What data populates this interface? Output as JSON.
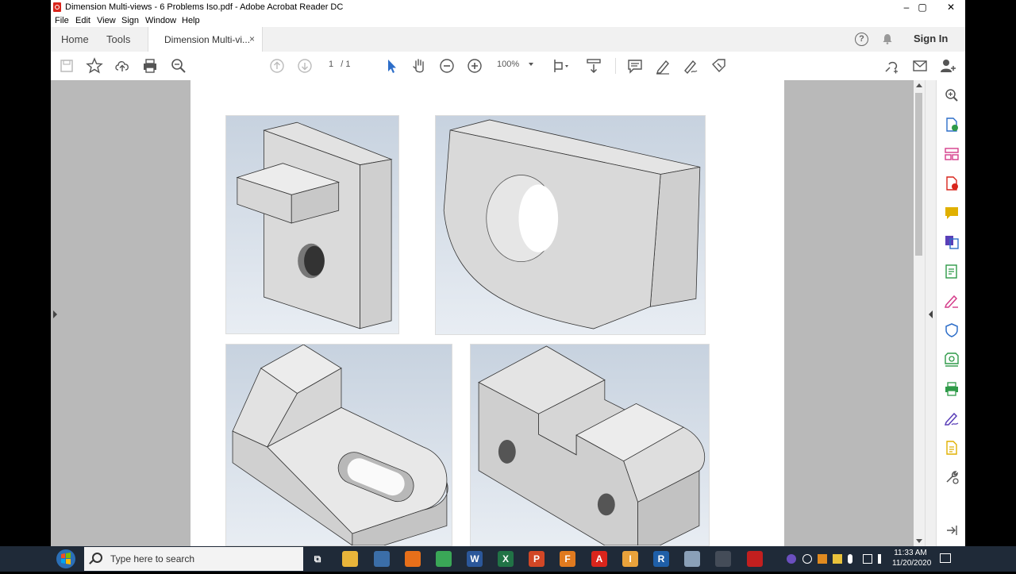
{
  "window": {
    "title": "Dimension Multi-views - 6 Problems Iso.pdf - Adobe Acrobat Reader DC",
    "controls": {
      "minimize": "–",
      "maximize": "▢",
      "close": "✕"
    }
  },
  "menu": [
    "File",
    "Edit",
    "View",
    "Sign",
    "Window",
    "Help"
  ],
  "tabs": {
    "home": "Home",
    "tools": "Tools",
    "document": "Dimension Multi-vi...",
    "close": "×"
  },
  "header": {
    "help": "?",
    "sign_in": "Sign In"
  },
  "toolbar": {
    "current_page": "1",
    "page_total": "/ 1",
    "zoom": "100%",
    "icons": [
      "save-icon",
      "bookmark-star-icon",
      "upload-cloud-icon",
      "print-icon",
      "find-magnifier-icon",
      "page-up-icon",
      "page-down-icon",
      "select-cursor-icon",
      "hand-pan-icon",
      "zoom-out-icon",
      "zoom-in-icon",
      "fit-page-icon",
      "scroll-mode-icon",
      "comment-icon",
      "highlight-pen-icon",
      "sign-icon",
      "fill-sign-icon",
      "share-link-icon",
      "email-icon",
      "add-user-icon"
    ]
  },
  "right_pane_tools": [
    "search-zoom-icon",
    "export-pdf-icon",
    "organize-pages-icon",
    "create-pdf-icon",
    "comment-icon",
    "combine-files-icon",
    "edit-pdf-icon",
    "fill-sign-icon",
    "protect-shield-icon",
    "scan-ocr-icon",
    "print-production-icon",
    "send-sign-icon",
    "rich-media-icon",
    "more-tools-wrench-icon",
    "collapse-pane-icon"
  ],
  "taskbar": {
    "search_placeholder": "Type here to search",
    "time": "11:33 AM",
    "date": "11/20/2020",
    "apps": [
      {
        "name": "task-view",
        "label": "⧉",
        "color": "#1f2a38"
      },
      {
        "name": "file-explorer",
        "label": "",
        "color": "#e8b43a"
      },
      {
        "name": "calculator",
        "label": "",
        "color": "#3b6ea8"
      },
      {
        "name": "firefox",
        "label": "",
        "color": "#e76f1a"
      },
      {
        "name": "chrome",
        "label": "",
        "color": "#3aa757"
      },
      {
        "name": "word",
        "label": "W",
        "color": "#2b579a"
      },
      {
        "name": "excel",
        "label": "X",
        "color": "#217346"
      },
      {
        "name": "powerpoint",
        "label": "P",
        "color": "#d24726"
      },
      {
        "name": "app-f",
        "label": "F",
        "color": "#e07a1f"
      },
      {
        "name": "acrobat",
        "label": "A",
        "color": "#d9251c"
      },
      {
        "name": "app-i",
        "label": "I",
        "color": "#e9a23b"
      },
      {
        "name": "revit",
        "label": "R",
        "color": "#1f5fa8"
      },
      {
        "name": "app-cloud",
        "label": "",
        "color": "#8aa0b8"
      },
      {
        "name": "app-disc",
        "label": "",
        "color": "#444c58"
      },
      {
        "name": "acrobat-reader",
        "label": "",
        "color": "#c21f1f"
      }
    ]
  },
  "colors": {
    "accent_red": "#d9251c",
    "toolbar_blue": "#2d6ec9",
    "right_icons": [
      "#2d6ec9",
      "#2e9a48",
      "#d43c8a",
      "#d9251c",
      "#e0b000",
      "#5a3fb8",
      "#2e9a48",
      "#d43c8a",
      "#2d6ec9",
      "#2e9a48",
      "#2e9a48",
      "#5a3fb8",
      "#e0b000",
      "#555555",
      "#555555"
    ]
  }
}
